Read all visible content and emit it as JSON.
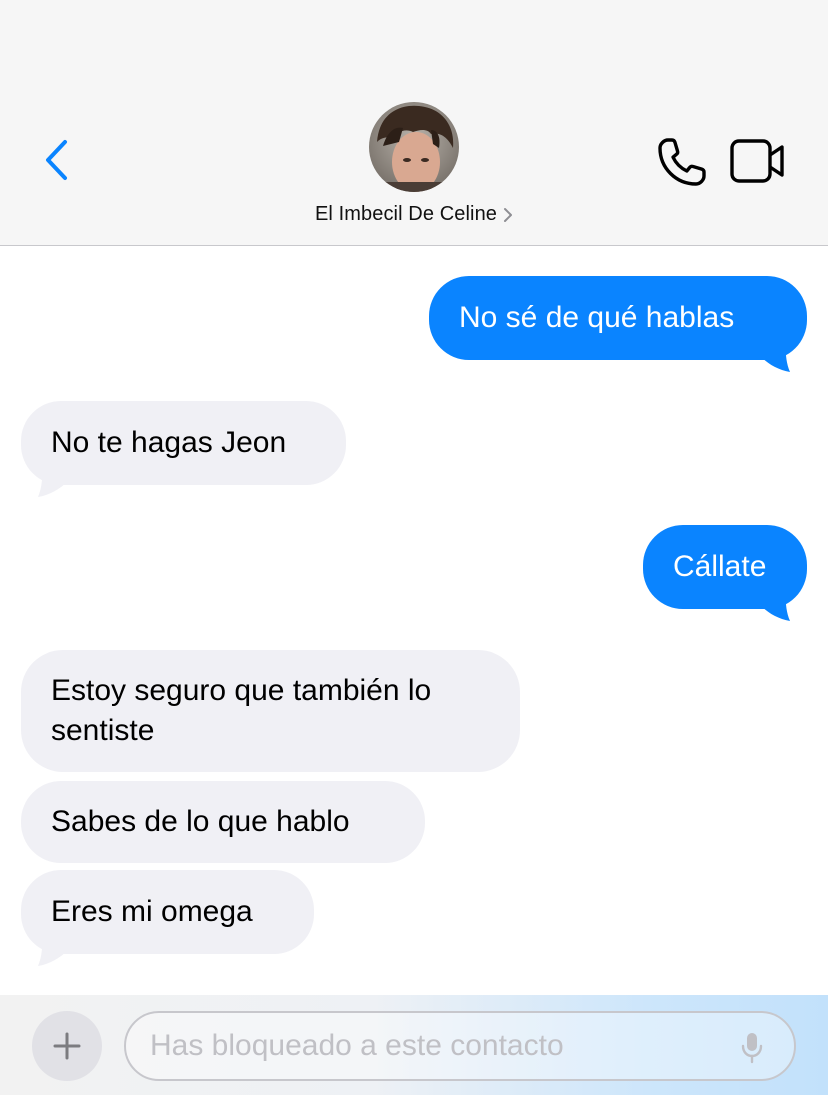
{
  "header": {
    "contact_name": "El Imbecil De Celine",
    "chevron": "chevron-right-icon",
    "back_icon": "chevron-left-icon",
    "phone_icon": "phone-icon",
    "video_icon": "video-camera-icon"
  },
  "messages": [
    {
      "direction": "outgoing",
      "text": "No sé de qué hablas"
    },
    {
      "direction": "incoming",
      "text": "No te hagas Jeon"
    },
    {
      "direction": "outgoing",
      "text": "Cállate"
    },
    {
      "direction": "incoming",
      "text": "Estoy seguro que también lo sentiste"
    },
    {
      "direction": "incoming",
      "text": "Sabes de lo que hablo"
    },
    {
      "direction": "incoming",
      "text": "Eres mi omega"
    }
  ],
  "composer": {
    "placeholder": "Has bloqueado a este contacto",
    "plus_icon": "plus-icon",
    "mic_icon": "microphone-icon"
  },
  "colors": {
    "outgoing_bubble": "#0a84ff",
    "incoming_bubble": "#f0f0f5",
    "accent": "#0a84ff"
  }
}
